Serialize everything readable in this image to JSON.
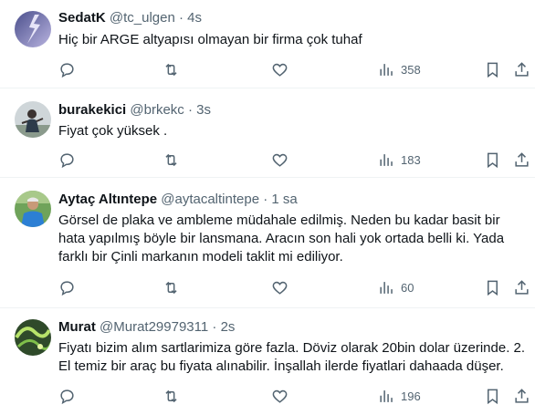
{
  "colors": {
    "text": "#0f1419",
    "secondary": "#536471",
    "divider": "#eff3f4"
  },
  "tweets": [
    {
      "name": "SedatK",
      "handle": "@tc_ulgen",
      "time": "4s",
      "text": "Hiç bir ARGE altyapısı olmayan bir firma çok tuhaf",
      "views": "358",
      "avatar": "lightning-sky-avatar"
    },
    {
      "name": "burakekici",
      "handle": "@brkekc",
      "time": "3s",
      "text": "Fiyat çok yüksek .",
      "views": "183",
      "avatar": "person-photo-avatar"
    },
    {
      "name": "Aytaç Altıntepe",
      "handle": "@aytacaltintepe",
      "time": "1 sa",
      "text": "Görsel de plaka ve ambleme müdahale edilmiş. Neden bu kadar basit bir hata yapılmış böyle bir lansmana. Aracın son hali yok ortada belli ki. Yada farklı bir Çinli markanın modeli taklit mi ediliyor.",
      "views": "60",
      "avatar": "person-blue-shirt-avatar"
    },
    {
      "name": "Murat",
      "handle": "@Murat29979311",
      "time": "2s",
      "text": "Fiyatı bizim alım sartlarimiza göre fazla. Döviz olarak 20bin dolar üzerinde. 2. El temiz bir araç bu fiyata alınabilir. İnşallah ilerde fiyatlari dahaada düşer.",
      "views": "196",
      "avatar": "green-abstract-avatar"
    }
  ],
  "separator": "·"
}
